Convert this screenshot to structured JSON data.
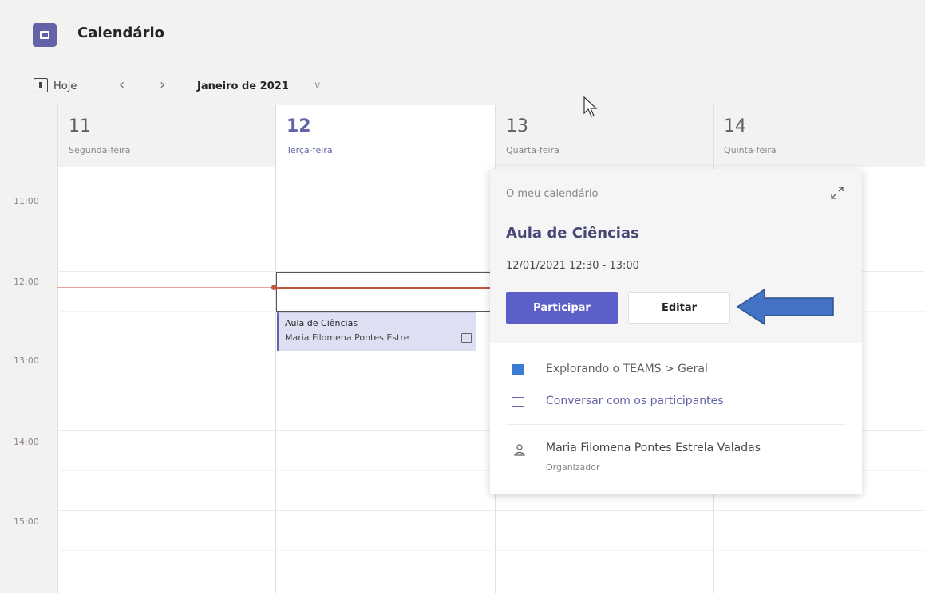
{
  "app": {
    "title": "Calendário",
    "icon": "calendar-icon"
  },
  "toolbar": {
    "today_label": "Hoje",
    "prev_icon": "chevron-left-icon",
    "next_icon": "chevron-right-icon",
    "month_label": "Janeiro de 2021"
  },
  "days": [
    {
      "number": "11",
      "name": "Segunda-feira",
      "today": false
    },
    {
      "number": "12",
      "name": "Terça-feira",
      "today": true
    },
    {
      "number": "13",
      "name": "Quarta-feira",
      "today": false
    },
    {
      "number": "14",
      "name": "Quinta-feira",
      "today": false
    }
  ],
  "hours": [
    "11:00",
    "12:00",
    "13:00",
    "14:00",
    "15:00"
  ],
  "event": {
    "title": "Aula de Ciências",
    "organizer_short": "Maria Filomena Pontes Estre"
  },
  "popup": {
    "calendar_label": "O meu calendário",
    "title": "Aula de Ciências",
    "time": "12/01/2021 12:30 - 13:00",
    "join_label": "Participar",
    "edit_label": "Editar",
    "channel_text": "Explorando o TEAMS > Geral",
    "chat_text": "Conversar com os participantes",
    "organizer_name": "Maria Filomena Pontes Estrela Valadas",
    "organizer_role": "Organizador"
  },
  "colors": {
    "accent": "#6264a7",
    "join_button": "#5b5fc7",
    "current_time": "#c4573e",
    "annotation_arrow": "#4472c4"
  }
}
